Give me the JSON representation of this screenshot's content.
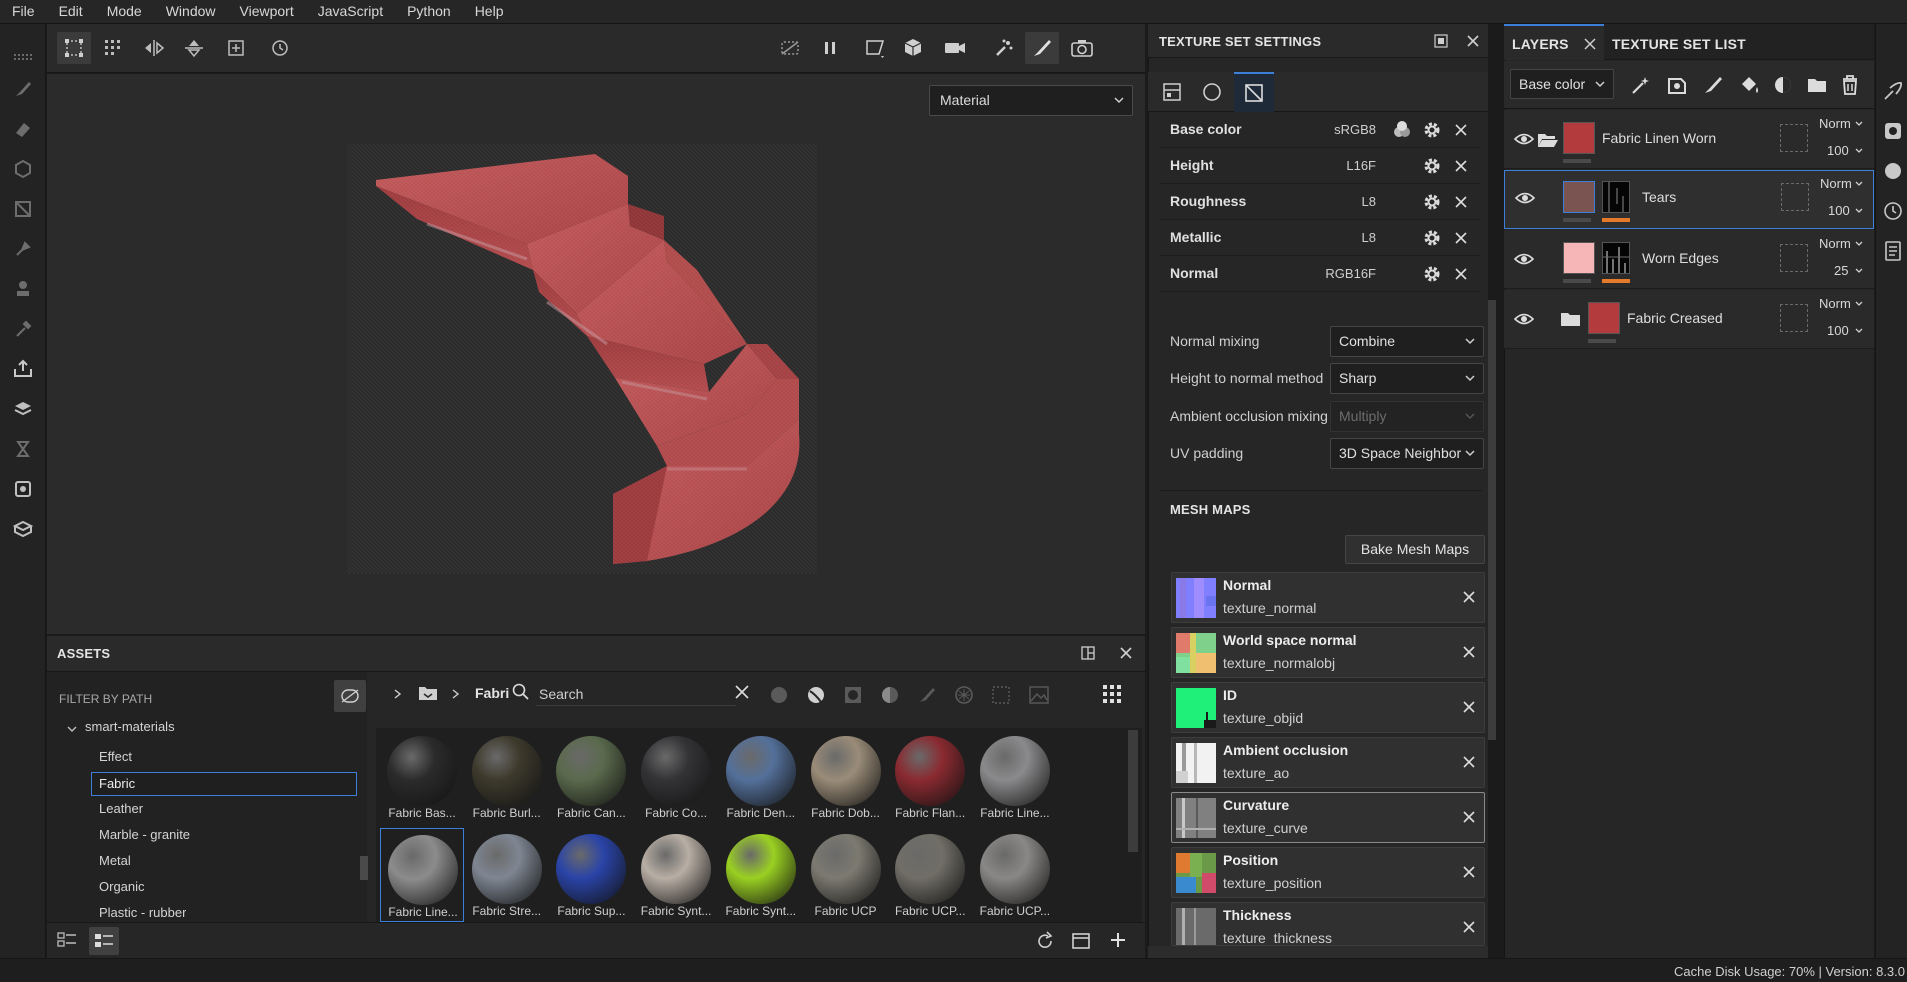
{
  "menubar": {
    "items": [
      "File",
      "Edit",
      "Mode",
      "Window",
      "Viewport",
      "JavaScript",
      "Python",
      "Help"
    ]
  },
  "viewport": {
    "display_mode": "Material",
    "toolbar_icons": [
      "transform-icon",
      "grid-snap-icon",
      "mirror-x-icon",
      "mirror-y-icon",
      "frame-icon",
      "history-icon",
      "hide-icon",
      "pause-icon",
      "perspective-icon",
      "cube-icon",
      "camera-icon",
      "particle-brush-icon",
      "paint-brush-icon",
      "screenshot-icon"
    ]
  },
  "assets": {
    "title": "ASSETS",
    "filter_label": "FILTER BY PATH",
    "tree_root": "smart-materials",
    "tree_items": [
      "Effect",
      "Fabric",
      "Leather",
      "Marble - granite",
      "Metal",
      "Organic",
      "Plastic - rubber"
    ],
    "selected_tree_item": "Fabric",
    "breadcrumb": "Fabri",
    "search_placeholder": "Search",
    "thumbnails": [
      {
        "label": "Fabric Bas...",
        "color": "#2b2b2b"
      },
      {
        "label": "Fabric Burl...",
        "color": "#3d3a2c"
      },
      {
        "label": "Fabric Can...",
        "color": "#5a6a4c"
      },
      {
        "label": "Fabric Co...",
        "color": "#333336"
      },
      {
        "label": "Fabric Den...",
        "color": "#54709a"
      },
      {
        "label": "Fabric Dob...",
        "color": "#9a8c78"
      },
      {
        "label": "Fabric Flan...",
        "color": "#8a2a30"
      },
      {
        "label": "Fabric Line...",
        "color": "#8a8a8c"
      },
      {
        "label": "Fabric Line...",
        "color": "#8c8c8c"
      },
      {
        "label": "Fabric Stre...",
        "color": "#7e8692"
      },
      {
        "label": "Fabric Sup...",
        "color": "#2a44a8"
      },
      {
        "label": "Fabric Synt...",
        "color": "#b8aea4"
      },
      {
        "label": "Fabric Synt...",
        "color": "#9ad022"
      },
      {
        "label": "Fabric UCP",
        "color": "#7c7a70"
      },
      {
        "label": "Fabric UCP...",
        "color": "#706e66"
      },
      {
        "label": "Fabric UCP...",
        "color": "#8a8886"
      }
    ]
  },
  "texture_set_settings": {
    "title": "TEXTURE SET SETTINGS",
    "channels": [
      {
        "name": "Base color",
        "format": "sRGB8"
      },
      {
        "name": "Height",
        "format": "L16F"
      },
      {
        "name": "Roughness",
        "format": "L8"
      },
      {
        "name": "Metallic",
        "format": "L8"
      },
      {
        "name": "Normal",
        "format": "RGB16F"
      }
    ],
    "params": [
      {
        "label": "Normal mixing",
        "value": "Combine",
        "disabled": false
      },
      {
        "label": "Height to normal method",
        "value": "Sharp",
        "disabled": false
      },
      {
        "label": "Ambient occlusion mixing",
        "value": "Multiply",
        "disabled": true
      },
      {
        "label": "UV padding",
        "value": "3D Space Neighbor",
        "disabled": false
      }
    ],
    "mesh_maps_title": "MESH MAPS",
    "bake_button": "Bake Mesh Maps",
    "mesh_maps": [
      {
        "name": "Normal",
        "texture": "texture_normal"
      },
      {
        "name": "World space normal",
        "texture": "texture_normalobj"
      },
      {
        "name": "ID",
        "texture": "texture_objid"
      },
      {
        "name": "Ambient occlusion",
        "texture": "texture_ao"
      },
      {
        "name": "Curvature",
        "texture": "texture_curve"
      },
      {
        "name": "Position",
        "texture": "texture_position"
      },
      {
        "name": "Thickness",
        "texture": "texture_thickness"
      }
    ]
  },
  "layers": {
    "tab_layers": "LAYERS",
    "tab_texture_set_list": "TEXTURE SET LIST",
    "channel_select": "Base color",
    "items": [
      {
        "name": "Fabric Linen Worn",
        "blend": "Norm",
        "opacity": "100"
      },
      {
        "name": "Tears",
        "blend": "Norm",
        "opacity": "100"
      },
      {
        "name": "Worn Edges",
        "blend": "Norm",
        "opacity": "25"
      },
      {
        "name": "Fabric Creased",
        "blend": "Norm",
        "opacity": "100"
      }
    ]
  },
  "status": {
    "text": "Cache Disk Usage:  70% | Version: 8.3.0"
  }
}
